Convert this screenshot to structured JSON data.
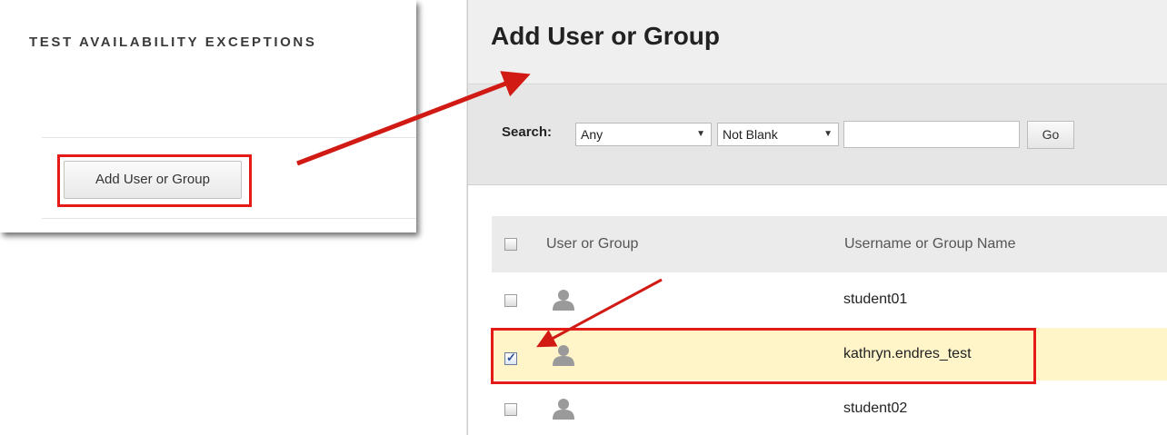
{
  "left_panel": {
    "title": "TEST AVAILABILITY EXCEPTIONS",
    "add_button_label": "Add User or Group"
  },
  "right_panel": {
    "page_title": "Add User or Group",
    "search": {
      "label": "Search:",
      "field_select": "Any",
      "operator_select": "Not Blank",
      "input_value": "",
      "go_label": "Go"
    },
    "table": {
      "headers": {
        "user_or_group": "User or Group",
        "username_or_group_name": "Username or Group Name"
      },
      "rows": [
        {
          "name": "student01",
          "checked": false
        },
        {
          "name": "kathryn.endres_test",
          "checked": true
        },
        {
          "name": "student02",
          "checked": false
        }
      ]
    }
  },
  "colors": {
    "highlight_box": "#e41b17",
    "arrow": "#d11a14",
    "selected_row": "#fff5c9"
  }
}
